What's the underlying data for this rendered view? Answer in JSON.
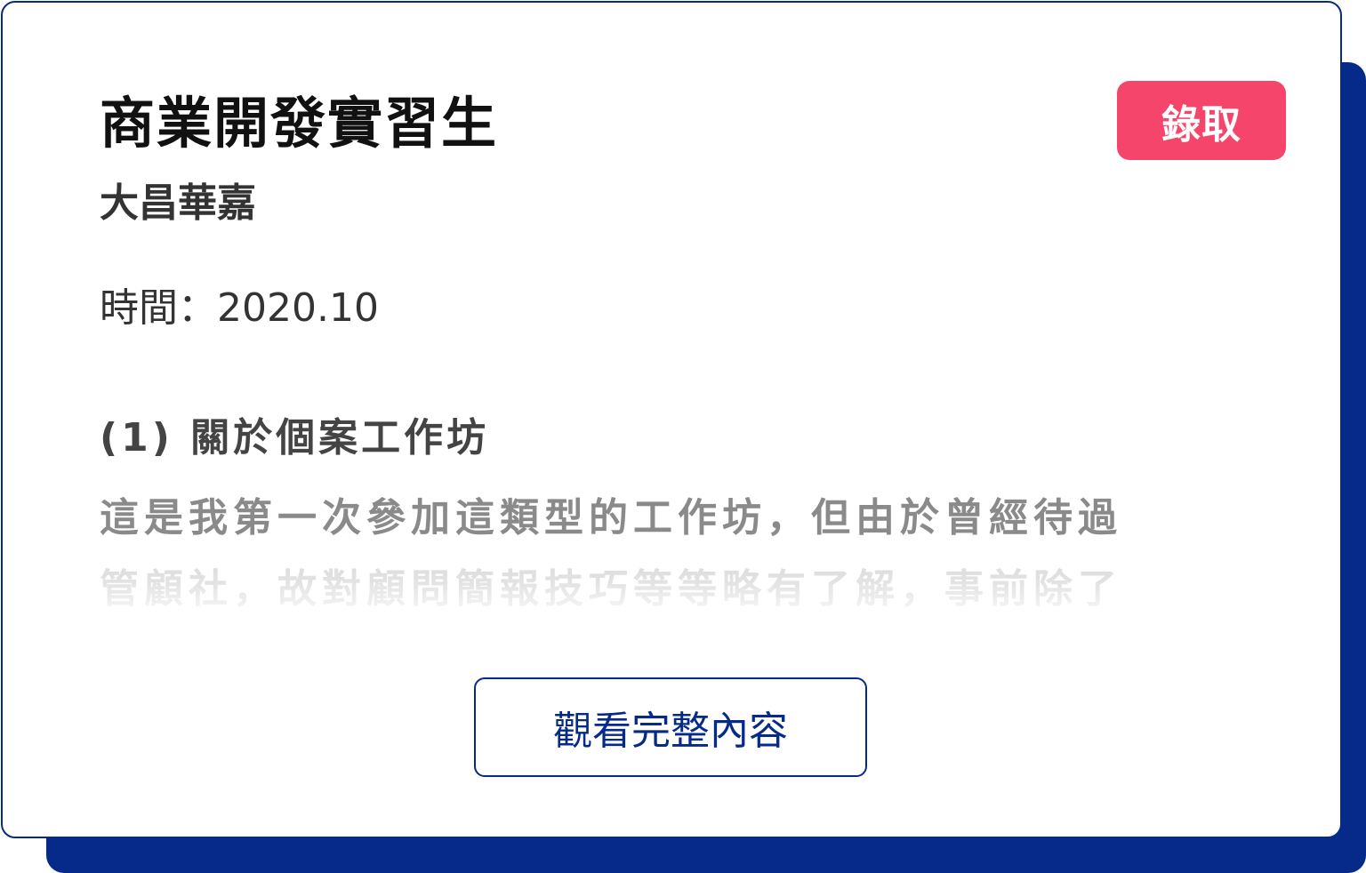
{
  "card": {
    "title": "商業開發實習生",
    "status_badge": "錄取",
    "company": "大昌華嘉",
    "date_label": "時間：",
    "date_value": "2020.10",
    "section_heading": "(1) 關於個案工作坊",
    "excerpt_lines": [
      "這是我第一次參加這類型的工作坊，但由於曾經待過",
      "管顧社，故對顧問簡報技巧等等略有了解，事前除了"
    ],
    "view_button_label": "觀看完整內容"
  },
  "colors": {
    "brand_navy": "#062a8a",
    "badge_pink": "#f6456a",
    "title_text": "#111111",
    "body_text": "#333333"
  }
}
